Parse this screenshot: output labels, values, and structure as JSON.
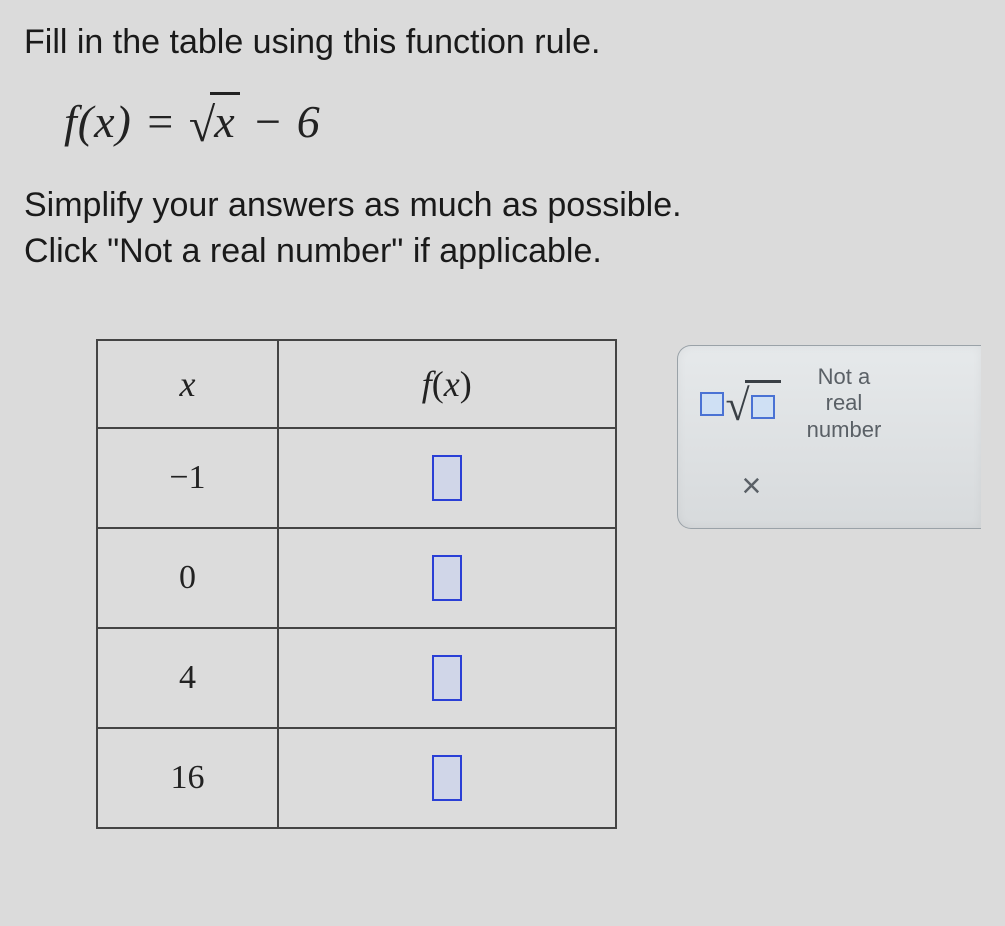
{
  "instruction": "Fill in the table using this function rule.",
  "function_rule": {
    "lhs": "f(x)",
    "equals": " = ",
    "sqrt_arg": "x",
    "after": " − 6"
  },
  "subtext_line1": "Simplify your answers as much as possible.",
  "subtext_line2": "Click \"Not a real number\" if applicable.",
  "table": {
    "headers": {
      "x": "x",
      "fx": "f(x)"
    },
    "rows": [
      {
        "x": "−1",
        "fx": ""
      },
      {
        "x": "0",
        "fx": ""
      },
      {
        "x": "4",
        "fx": ""
      },
      {
        "x": "16",
        "fx": ""
      }
    ]
  },
  "tools": {
    "not_real_l1": "Not a",
    "not_real_l2": "real",
    "not_real_l3": "number",
    "clear": "×"
  }
}
